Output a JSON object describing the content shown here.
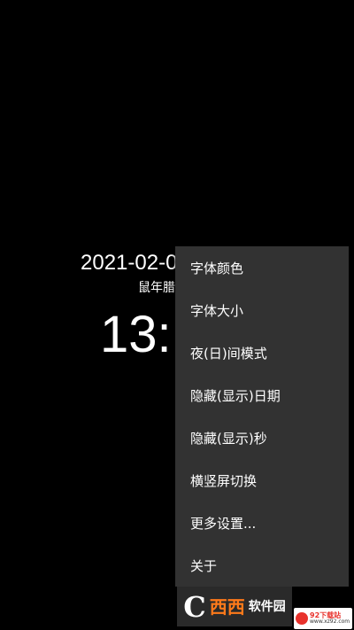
{
  "clock": {
    "date": "2021-02-0",
    "lunar": "鼠年腊",
    "time": "13:"
  },
  "menu": {
    "items": [
      {
        "label": "字体颜色"
      },
      {
        "label": "字体大小"
      },
      {
        "label": "夜(日)间模式"
      },
      {
        "label": "隐藏(显示)日期"
      },
      {
        "label": "隐藏(显示)秒"
      },
      {
        "label": "横竖屏切换"
      },
      {
        "label": "更多设置..."
      },
      {
        "label": "关于"
      }
    ]
  },
  "watermark": {
    "logo_letter": "C",
    "logo_xi": "西西",
    "logo_soft": "软件园",
    "badge_name": "92下载站",
    "badge_url": "www.xz92.com"
  },
  "colors": {
    "background": "#000000",
    "menu_background": "#323232",
    "text": "#ffffff"
  }
}
